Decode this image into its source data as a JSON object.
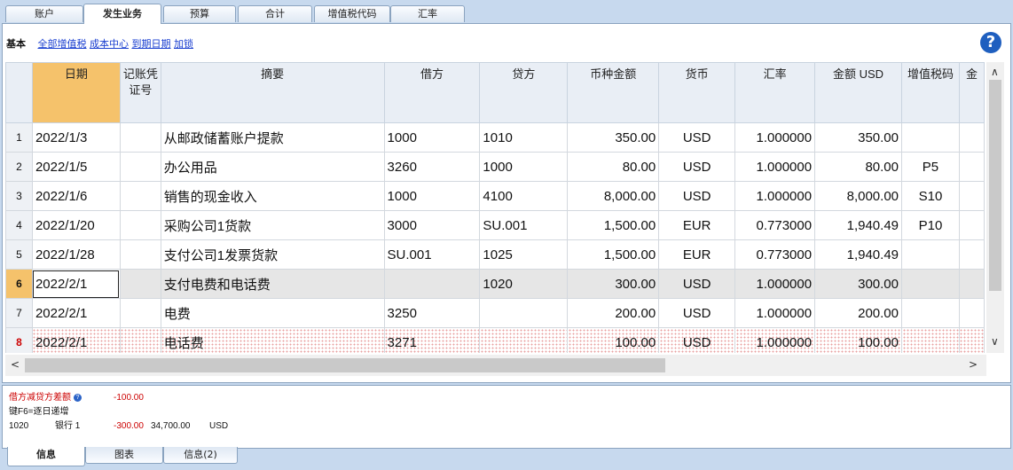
{
  "top_tabs": [
    "账户",
    "发生业务",
    "预算",
    "合计",
    "增值税代码",
    "汇率"
  ],
  "subtabs": {
    "basic": "基本",
    "links": [
      "全部增值税",
      "成本中心",
      "到期日期",
      "加锁"
    ]
  },
  "help_icon": "?",
  "columns": [
    "日期",
    "记账凭证号",
    "摘要",
    "借方",
    "贷方",
    "币种金额",
    "货币",
    "汇率",
    "金额 USD",
    "增值税码",
    "金"
  ],
  "rows": [
    {
      "n": "1",
      "date": "2022/1/3",
      "doc": "",
      "desc": "从邮政储蓄账户提款",
      "debit": "1000",
      "credit": "1010",
      "amtcur": "350.00",
      "cur": "USD",
      "rate": "1.000000",
      "amt": "350.00",
      "vat": ""
    },
    {
      "n": "2",
      "date": "2022/1/5",
      "doc": "",
      "desc": "办公用品",
      "debit": "3260",
      "credit": "1000",
      "amtcur": "80.00",
      "cur": "USD",
      "rate": "1.000000",
      "amt": "80.00",
      "vat": "P5"
    },
    {
      "n": "3",
      "date": "2022/1/6",
      "doc": "",
      "desc": "销售的现金收入",
      "debit": "1000",
      "credit": "4100",
      "amtcur": "8,000.00",
      "cur": "USD",
      "rate": "1.000000",
      "amt": "8,000.00",
      "vat": "S10"
    },
    {
      "n": "4",
      "date": "2022/1/20",
      "doc": "",
      "desc": "采购公司1货款",
      "debit": "3000",
      "credit": "SU.001",
      "amtcur": "1,500.00",
      "cur": "EUR",
      "rate": "0.773000",
      "amt": "1,940.49",
      "vat": "P10"
    },
    {
      "n": "5",
      "date": "2022/1/28",
      "doc": "",
      "desc": "支付公司1发票货款",
      "debit": "SU.001",
      "credit": "1025",
      "amtcur": "1,500.00",
      "cur": "EUR",
      "rate": "0.773000",
      "amt": "1,940.49",
      "vat": ""
    },
    {
      "n": "6",
      "date": "2022/2/1",
      "doc": "",
      "desc": "支付电费和电话费",
      "debit": "",
      "credit": "1020",
      "amtcur": "300.00",
      "cur": "USD",
      "rate": "1.000000",
      "amt": "300.00",
      "vat": ""
    },
    {
      "n": "7",
      "date": "2022/2/1",
      "doc": "",
      "desc": "电费",
      "debit": "3250",
      "credit": "",
      "amtcur": "200.00",
      "cur": "USD",
      "rate": "1.000000",
      "amt": "200.00",
      "vat": ""
    },
    {
      "n": "8",
      "date": "2022/2/1",
      "doc": "",
      "desc": "电话费",
      "debit": "3271",
      "credit": "",
      "amtcur": "100.00",
      "cur": "USD",
      "rate": "1.000000",
      "amt": "100.00",
      "vat": ""
    }
  ],
  "info": {
    "line1_label": "借方减贷方差额",
    "line1_value": "-100.00",
    "line2": "键F6=逐日递增",
    "line3_account": "1020",
    "line3_name": "银行 1",
    "line3_value": "-300.00",
    "line3_balance": "34,700.00",
    "line3_currency": "USD"
  },
  "bottom_tabs": [
    "信息",
    "图表",
    "信息(2)"
  ]
}
